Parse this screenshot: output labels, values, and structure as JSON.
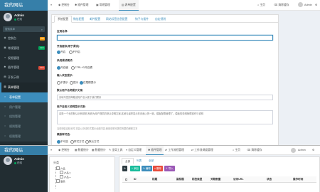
{
  "top": {
    "site_title": "我的网站",
    "user_name": "Admin",
    "user_status": "在线",
    "search_placeholder": "搜索菜单",
    "menu": [
      {
        "icon": "dashboard-icon",
        "label": "控制台",
        "badge": "hot"
      },
      {
        "icon": "cube-icon",
        "label": "常规管理",
        "badge": "new"
      },
      {
        "icon": "list-icon",
        "label": "权限管理",
        "badge": ""
      },
      {
        "icon": "gear-icon",
        "label": "插件管理",
        "badge": "new"
      },
      {
        "icon": "book-icon",
        "label": "开发示例",
        "badge": ""
      },
      {
        "icon": "file-icon",
        "label": "表单管理",
        "badge": ""
      }
    ],
    "submenu": [
      "表单配置",
      "用户管理",
      "组别管理",
      "规则管理",
      "权限管理"
    ],
    "top_tabs": [
      "控制台",
      "插件管理",
      "常规管理",
      "表单配置"
    ],
    "top_right": [
      "主页",
      "清除缓存",
      "Admin"
    ],
    "form_tabs": [
      "系统配置",
      "微信配置",
      "邮件配置",
      "网站标签信息配置",
      "钩子与插件",
      "自定规则"
    ],
    "form": {
      "site_name_label": "应用名称:",
      "site_name_value": "",
      "cache_label": "开启缓存(用于调试):",
      "cache_options": [
        "开启",
        "不开启"
      ],
      "captcha_label": "系统调试模式:",
      "captcha_options": [
        "开启缓",
        "CTRL+D开启模"
      ],
      "display_label": "输入状态提示:",
      "display_options": [
        "不提示",
        "提示",
        "仅限模提示"
      ],
      "placeholder_label": "默认用户名称提示文案:",
      "placeholder_value": "请填写您的邮箱或用户名以便于我们联系",
      "description_label": "用户自定义说明提示文案:",
      "description_value": "这是一个长的默认示例说明,系统为用户提供的默认说明文案,这就与最终显示在页面上的一致。模板配置管理了。模板的说明管理操作与说明",
      "description_help": "当说明信息较长时,将会以浮动形式展示全部内容,使用说明可提供完整的解释文本",
      "style_label": "模版样式选:",
      "style_options": [
        "不可选",
        "样式方式",
        "默认方式"
      ]
    }
  },
  "bottom": {
    "site_title": "我的网站",
    "user_name": "Admin",
    "user_status": "在线",
    "top_tabs": [
      "控制台",
      "数据统计",
      "数据统计",
      "全局工具",
      "自定义管理",
      "插件管理",
      "工作流程管理",
      "工作流调度管理"
    ],
    "top_right": [
      "主页",
      "清除缓存",
      "Admin"
    ],
    "tree_title": "分类",
    "tree_nodes": [
      "产品",
      "产品二",
      "产品一",
      "服务"
    ],
    "grid_tabs": [
      "全部",
      "列表",
      "全部"
    ],
    "buttons": [
      "刷新",
      "添加",
      "编辑",
      "删除",
      "导入"
    ],
    "columns": [
      "ID",
      "标题",
      "副标题",
      "标签类型",
      "关联数量",
      "访问URL",
      "状态",
      "操作时间"
    ]
  },
  "colors": {
    "sidebar": "#222d32",
    "logo": "#367fa9",
    "accent": "#3c8dbc",
    "content_bg": "#ecf0f5"
  }
}
